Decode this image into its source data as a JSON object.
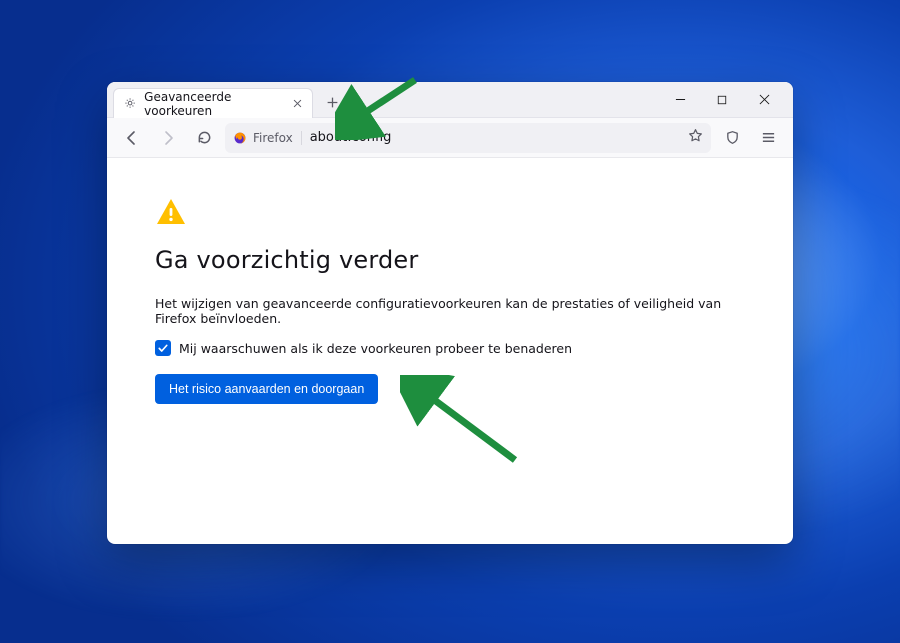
{
  "tab": {
    "title": "Geavanceerde voorkeuren"
  },
  "urlbar": {
    "identity_label": "Firefox",
    "address": "about:config"
  },
  "page": {
    "heading": "Ga voorzichtig verder",
    "description": "Het wijzigen van geavanceerde configuratievoorkeuren kan de prestaties of veiligheid van Firefox beïnvloeden.",
    "checkbox_label": "Mij waarschuwen als ik deze voorkeuren probeer te benaderen",
    "checkbox_checked": true,
    "button_label": "Het risico aanvaarden en doorgaan"
  },
  "colors": {
    "primary": "#0060df",
    "warning": "#ffbf00",
    "annotation": "#1e8e3e"
  }
}
